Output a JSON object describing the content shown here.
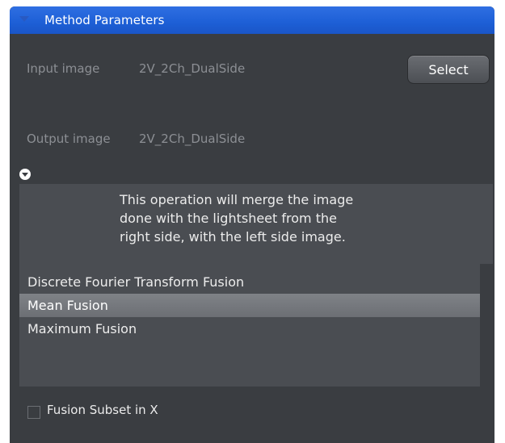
{
  "panel": {
    "title": "Method Parameters"
  },
  "input": {
    "label": "Input image",
    "value": "2V_2Ch_DualSide",
    "button": "Select"
  },
  "output": {
    "label": "Output image",
    "value": "2V_2Ch_DualSide"
  },
  "info": {
    "lines": [
      "This operation will merge the image",
      "done with the lightsheet from the",
      "right side, with the left side image."
    ]
  },
  "methods": {
    "items": [
      "Discrete Fourier Transform Fusion",
      "Mean Fusion",
      "Maximum Fusion"
    ],
    "selected": "Mean Fusion"
  },
  "options": {
    "fusion_subset_label": "Fusion Subset in X",
    "fusion_subset_checked": false
  },
  "colors": {
    "header": "#1d5fd6",
    "panel_bg": "#3a3d41",
    "box_bg": "#4a4d52"
  }
}
